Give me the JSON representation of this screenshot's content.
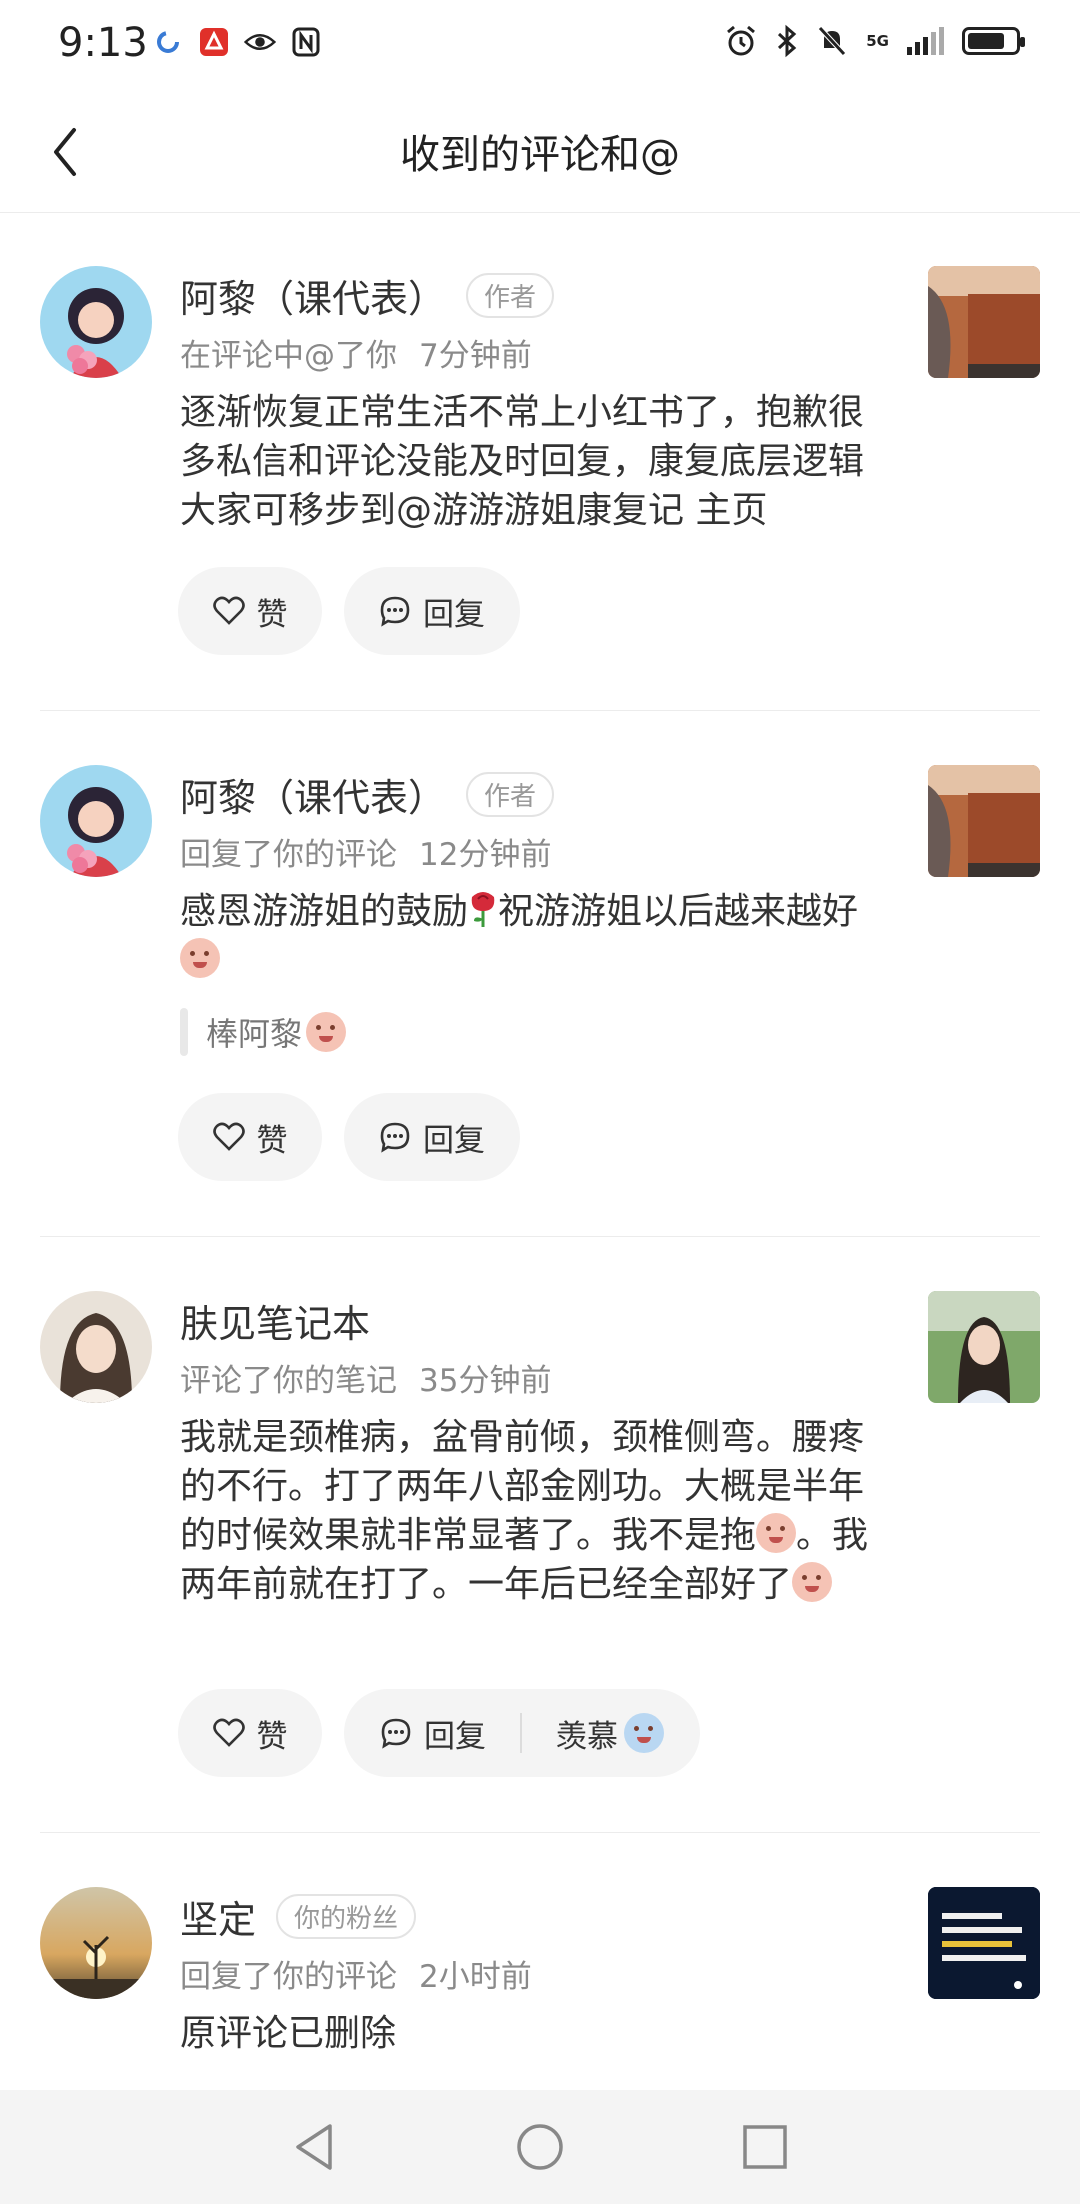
{
  "status_bar": {
    "time": "9:13",
    "network": "5G"
  },
  "header": {
    "title": "收到的评论和@"
  },
  "comments": [
    {
      "name": "阿黎（课代表）",
      "tag": "作者",
      "action": "在评论中@了你",
      "time": "7分钟前",
      "text": "逐渐恢复正常生活不常上小红书了，抱歉很多私信和评论没能及时回复，康复底层逻辑大家可移步到@游游游姐康复记 主页",
      "like_label": "赞",
      "reply_label": "回复"
    },
    {
      "name": "阿黎（课代表）",
      "tag": "作者",
      "action": "回复了你的评论",
      "time": "12分钟前",
      "text_part1": "感恩游游姐的鼓励",
      "text_part2": "祝游游姐以后越来越好",
      "quote": "棒阿黎",
      "like_label": "赞",
      "reply_label": "回复"
    },
    {
      "name": "肤见笔记本",
      "action": "评论了你的笔记",
      "time": "35分钟前",
      "text_part1": "我就是颈椎病，盆骨前倾，颈椎侧弯。腰疼的不行。打了两年八部金刚功。大概是半年的时候效果就非常显著了。我不是拖",
      "text_part2": "。我两年前就在打了。一年后已经全部好了",
      "like_label": "赞",
      "reply_label": "回复",
      "extra_label": "羡慕"
    },
    {
      "name": "坚定",
      "tag": "你的粉丝",
      "action": "回复了你的评论",
      "time": "2小时前",
      "text": "原评论已删除"
    }
  ]
}
